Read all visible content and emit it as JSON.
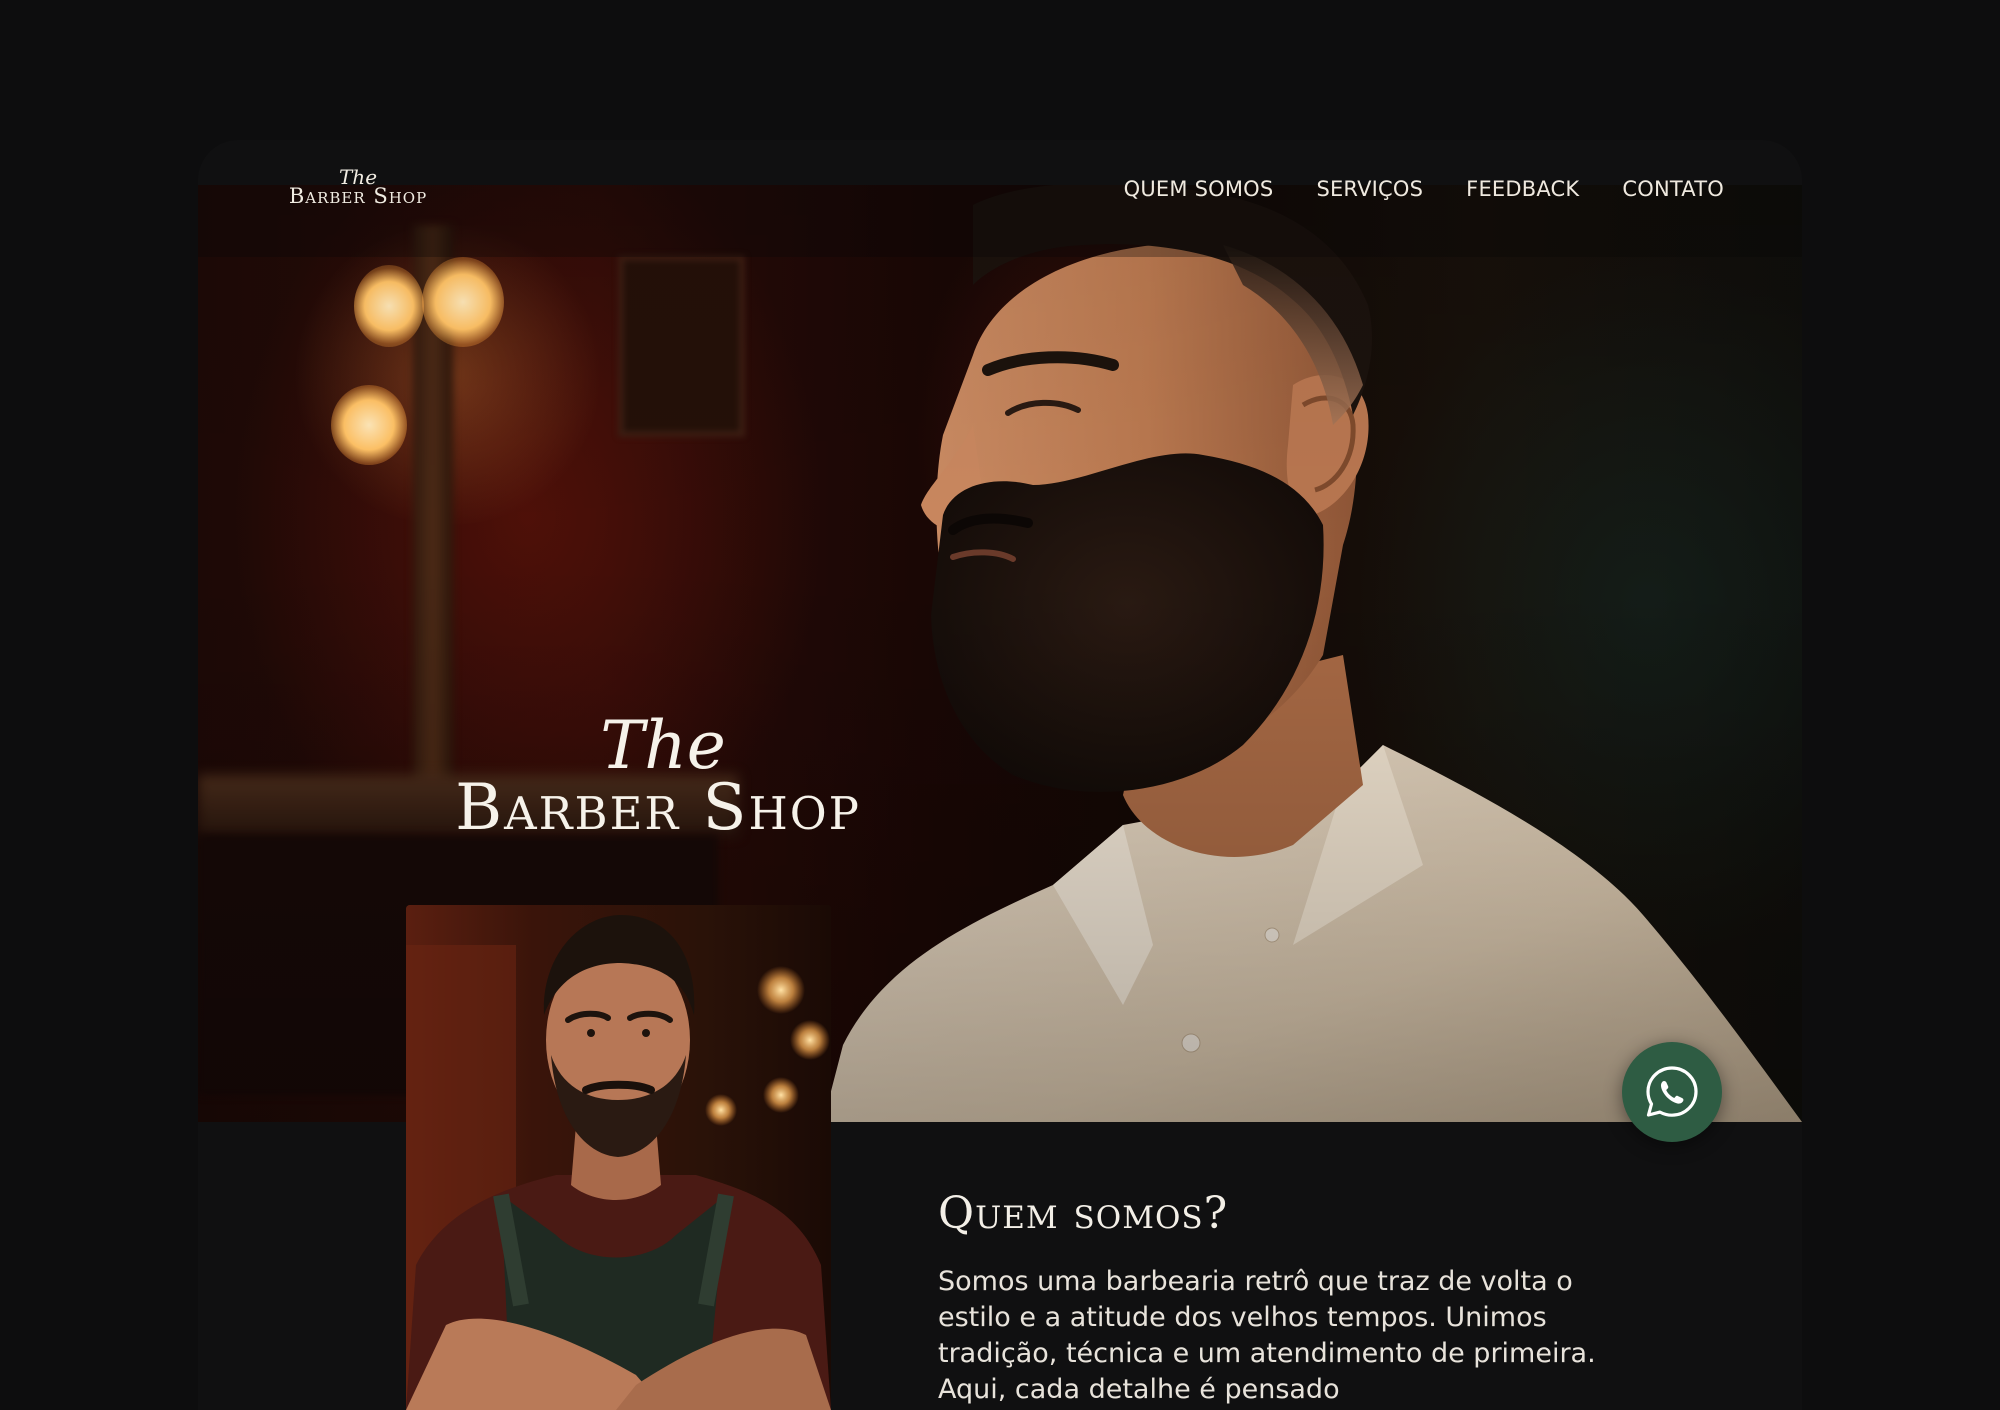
{
  "brand": {
    "the": "The",
    "name": "Barber Shop"
  },
  "nav": {
    "items": [
      {
        "label": "QUEM SOMOS"
      },
      {
        "label": "SERVIÇOS"
      },
      {
        "label": "FEEDBACK"
      },
      {
        "label": "CONTATO"
      }
    ]
  },
  "hero": {
    "logo_the": "The",
    "logo_name": "Barber Shop"
  },
  "about": {
    "title": "Quem somos?",
    "text": "Somos uma barbearia retrô que traz de volta o estilo e a atitude dos velhos tempos. Unimos tradição, técnica e um atendimento de primeira. Aqui, cada detalhe é pensado"
  },
  "whatsapp": {
    "icon": "whatsapp-icon",
    "color": "#2e5c43"
  },
  "colors": {
    "background": "#0d0d0e",
    "text": "#f1ece2",
    "accent": "#2e5c43"
  }
}
